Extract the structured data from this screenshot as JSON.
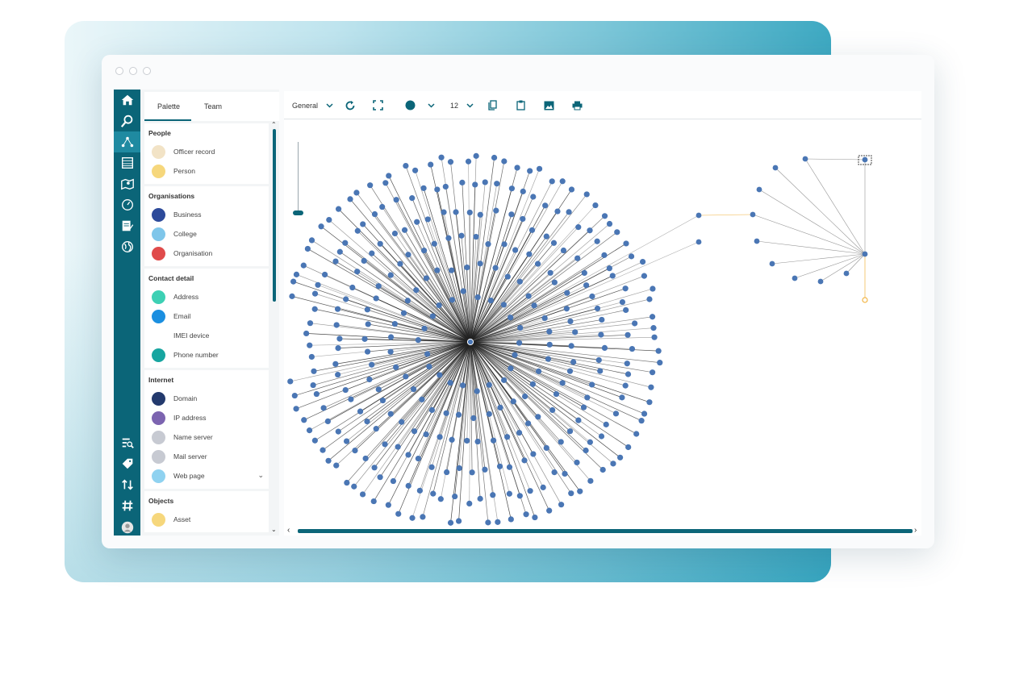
{
  "palette": {
    "tabs": [
      {
        "label": "Palette"
      },
      {
        "label": "Team"
      }
    ],
    "groups": [
      {
        "title": "People",
        "items": [
          {
            "label": "Officer record",
            "color": "#f2e3c6",
            "icon": "officer-icon"
          },
          {
            "label": "Person",
            "color": "#f6d77c",
            "icon": "person-icon"
          }
        ]
      },
      {
        "title": "Organisations",
        "items": [
          {
            "label": "Business",
            "color": "#2d4a9a",
            "icon": "business-icon"
          },
          {
            "label": "College",
            "color": "#7fc6ea",
            "icon": "college-icon"
          },
          {
            "label": "Organisation",
            "color": "#e04b4b",
            "icon": "organisation-icon"
          }
        ]
      },
      {
        "title": "Contact detail",
        "items": [
          {
            "label": "Address",
            "color": "#3dd0b4",
            "icon": "address-icon"
          },
          {
            "label": "Email",
            "color": "#1b8fe0",
            "icon": "email-icon"
          },
          {
            "label": "IMEI device",
            "color": "#ffffff",
            "icon": "imei-device-icon"
          },
          {
            "label": "Phone number",
            "color": "#17a5a0",
            "icon": "phone-number-icon"
          }
        ]
      },
      {
        "title": "Internet",
        "items": [
          {
            "label": "Domain",
            "color": "#233a6d",
            "icon": "domain-icon"
          },
          {
            "label": "IP address",
            "color": "#7c64b0",
            "icon": "ip-address-icon"
          },
          {
            "label": "Name server",
            "color": "#c7cad2",
            "icon": "name-server-icon"
          },
          {
            "label": "Mail server",
            "color": "#c7cad2",
            "icon": "mail-server-icon"
          },
          {
            "label": "Web page",
            "color": "#8fd2f0",
            "icon": "web-page-icon"
          }
        ]
      },
      {
        "title": "Objects",
        "items": [
          {
            "label": "Asset",
            "color": "#f6d77c",
            "icon": "asset-icon"
          }
        ]
      }
    ]
  },
  "toolbar": {
    "layout_select": "General",
    "font_size": "12"
  },
  "graph": {
    "node_color": "#4a76b4",
    "edge_color": "#222222",
    "highlight_color": "#f2b544"
  }
}
